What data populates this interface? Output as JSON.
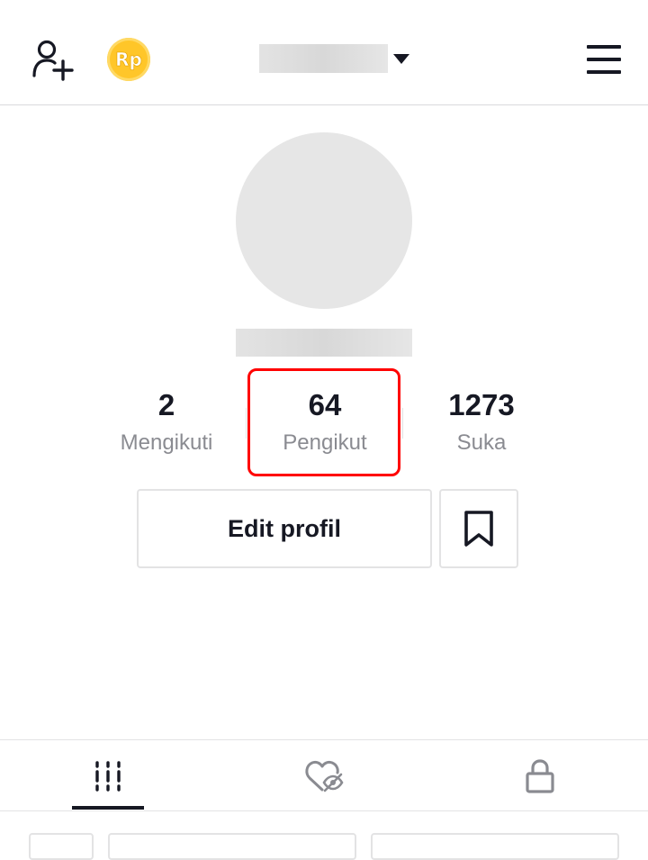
{
  "header": {
    "add_friend_icon": "person-add-icon",
    "coin_label": "Rp",
    "coin_color": "#FFC629",
    "dropdown_icon": "caret-down-icon",
    "menu_icon": "hamburger-menu-icon"
  },
  "profile": {
    "stats": [
      {
        "value": "2",
        "label": "Mengikuti"
      },
      {
        "value": "64",
        "label": "Pengikut"
      },
      {
        "value": "1273",
        "label": "Suka"
      }
    ],
    "highlight_color": "#FF0000",
    "edit_button_label": "Edit profil",
    "bookmark_icon": "bookmark-icon"
  },
  "tabs": [
    {
      "icon": "grid-bars-icon",
      "active": true
    },
    {
      "icon": "heart-hidden-icon",
      "active": false
    },
    {
      "icon": "lock-icon",
      "active": false
    }
  ]
}
